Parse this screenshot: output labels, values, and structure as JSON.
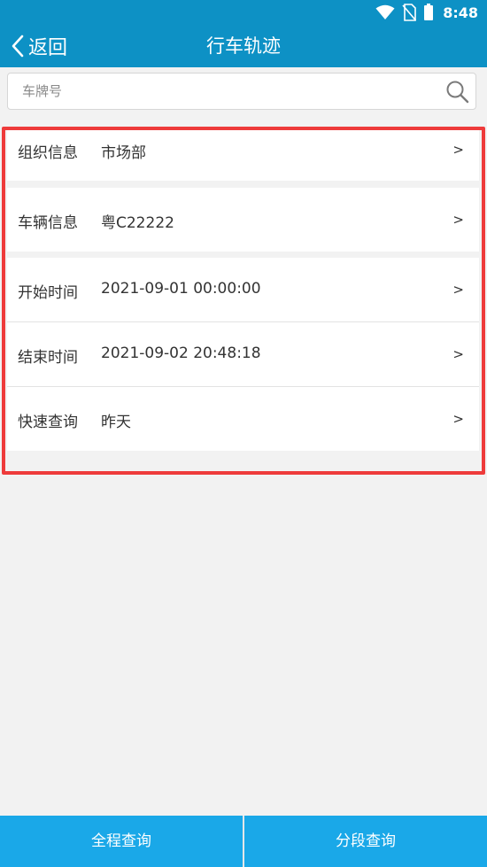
{
  "status_bar": {
    "time": "8:48",
    "icons": [
      "wifi-icon",
      "no-sim-icon",
      "battery-icon"
    ],
    "background": "#0d91c5"
  },
  "nav": {
    "back_label": "返回",
    "title": "行车轨迹"
  },
  "search": {
    "placeholder": "车牌号",
    "value": ""
  },
  "rows": [
    {
      "label": "组织信息",
      "value": "市场部",
      "chevron": ">"
    },
    {
      "label": "车辆信息",
      "value": "粤C22222",
      "chevron": ">"
    },
    {
      "label": "开始时间",
      "value": "2021-09-01 00:00:00",
      "chevron": ">"
    },
    {
      "label": "结束时间",
      "value": "2021-09-02 20:48:18",
      "chevron": ">"
    },
    {
      "label": "快速查询",
      "value": "昨天",
      "chevron": ">"
    }
  ],
  "bottom_bar": {
    "full_query": "全程查询",
    "segment_query": "分段查询",
    "background": "#1aa8e8"
  },
  "colors": {
    "accent": "#0d91c5",
    "highlight_border": "#ee3b3b"
  }
}
